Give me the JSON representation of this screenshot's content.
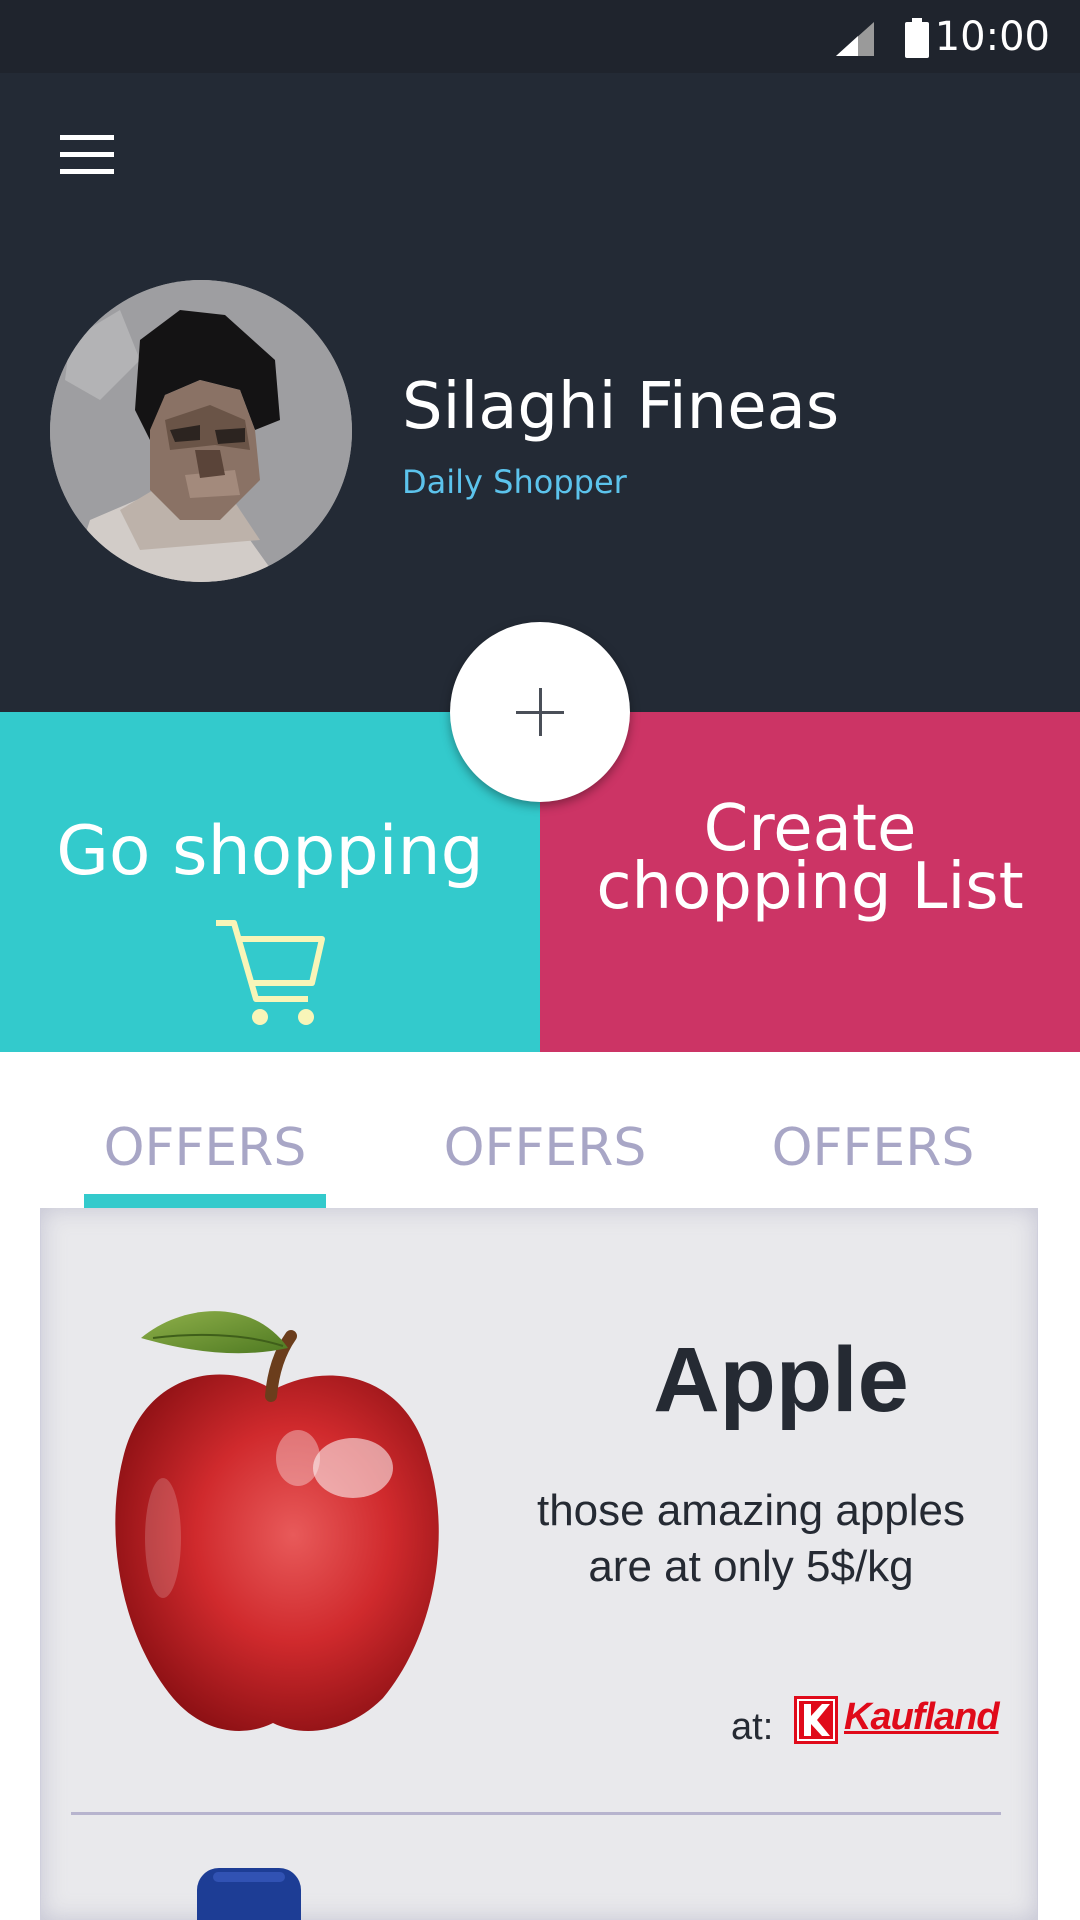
{
  "status_bar": {
    "time": "10:00",
    "icons": [
      "signal-icon",
      "battery-icon"
    ]
  },
  "header": {
    "menu_icon": "hamburger-menu-icon"
  },
  "profile": {
    "name": "Silaghi Fineas",
    "role": "Daily Shopper"
  },
  "fab": {
    "icon": "plus-icon"
  },
  "actions": {
    "go_shopping": {
      "label": "Go shopping",
      "icon": "shopping-cart-icon"
    },
    "create_list": {
      "line1": "Create",
      "line2": "chopping List"
    }
  },
  "tabs": [
    {
      "label": "OFFERS",
      "selected": true
    },
    {
      "label": "OFFERS",
      "selected": false
    },
    {
      "label": "OFFERS",
      "selected": false
    }
  ],
  "offers": [
    {
      "title": "Apple",
      "desc_line1": "those amazing apples",
      "desc_line2": "are at only 5$/kg",
      "at_label": "at:",
      "store_logo_text": "Kaufland",
      "image": "apple-image"
    }
  ],
  "colors": {
    "status_bg": "#1f242d",
    "header_bg": "#232a35",
    "role_text": "#5cc3ec",
    "go_shopping_bg": "#33cacc",
    "create_list_bg": "#cc3465",
    "tab_text": "#a8a6c6",
    "tab_indicator": "#33cacc",
    "cart_icon": "#f8f5b8",
    "store_red": "#e00a1a"
  }
}
